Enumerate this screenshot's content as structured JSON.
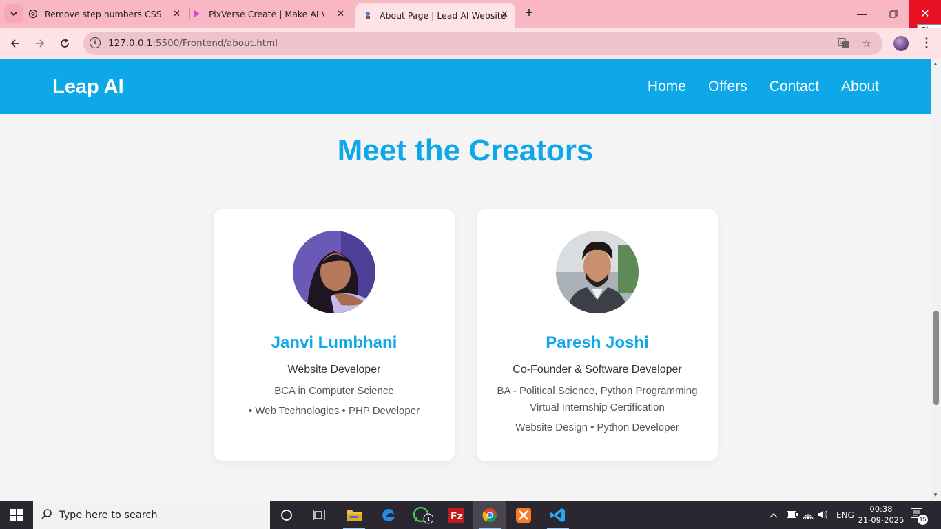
{
  "browser": {
    "tabs": [
      {
        "title": "Remove step numbers CSS",
        "icon": "chatgpt-icon"
      },
      {
        "title": "PixVerse Create | Make AI Video",
        "icon": "pixverse-icon"
      },
      {
        "title": "About Page | Lead AI Website",
        "icon": "page-favicon-icon",
        "active": true
      }
    ],
    "url_host": "127.0.0.1",
    "url_path": ":5500/Frontend/about.html",
    "close_tooltip": "Close"
  },
  "site": {
    "logo": "Leap AI",
    "nav": [
      "Home",
      "Offers",
      "Contact",
      "About"
    ],
    "heading": "Meet the Creators",
    "creators": [
      {
        "name": "Janvi Lumbhani",
        "role": "Website Developer",
        "details": [
          "BCA in Computer Science",
          "• Web Technologies • PHP Developer"
        ]
      },
      {
        "name": "Paresh Joshi",
        "role": "Co-Founder & Software Developer",
        "details": [
          "BA - Political Science, Python Programming",
          "Virtual Internship Certification",
          "Website Design • Python Developer"
        ]
      }
    ]
  },
  "taskbar": {
    "search_placeholder": "Type here to search",
    "language": "ENG",
    "time": "00:38",
    "date": "21-09-2025",
    "notification_count": "15",
    "whatsapp_badge": "1"
  },
  "colors": {
    "accent": "#0ea7e8",
    "tab_bar": "#f9b7c3",
    "close_button": "#e81123"
  }
}
